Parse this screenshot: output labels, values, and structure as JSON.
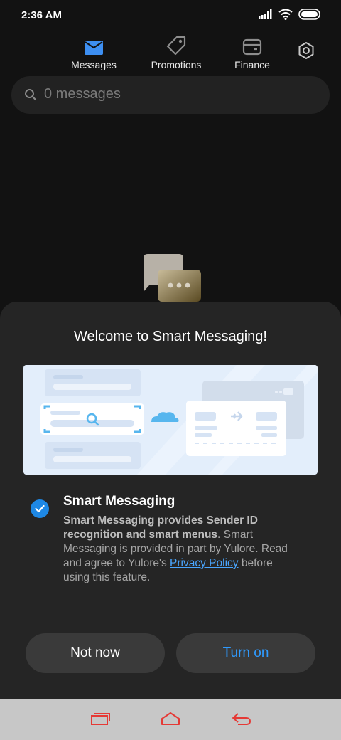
{
  "status_bar": {
    "time": "2:36 AM"
  },
  "tabs": [
    {
      "label": "Messages",
      "icon": "envelope-icon",
      "active": true
    },
    {
      "label": "Promotions",
      "icon": "tag-icon",
      "active": false
    },
    {
      "label": "Finance",
      "icon": "wallet-icon",
      "active": false
    }
  ],
  "search": {
    "placeholder": "0 messages"
  },
  "dialog": {
    "title": "Welcome to Smart Messaging!",
    "feature": {
      "title": "Smart Messaging",
      "desc_bold": "Smart Messaging provides Sender ID recognition and smart menus",
      "desc_text_1": ". Smart Messaging is provided in part by Yulore. Read and agree to Yulore's ",
      "desc_link": "Privacy Policy",
      "desc_text_2": " before using this feature.",
      "checked": true
    },
    "buttons": {
      "not_now": "Not now",
      "turn_on": "Turn on"
    }
  },
  "colors": {
    "accent": "#1e88e5",
    "link": "#4aa6ff",
    "turn_on_text": "#2f9bff",
    "nav_icons": "#e53935"
  },
  "nav_bar": {
    "icons": [
      "recent-apps-icon",
      "home-icon",
      "back-icon"
    ]
  }
}
